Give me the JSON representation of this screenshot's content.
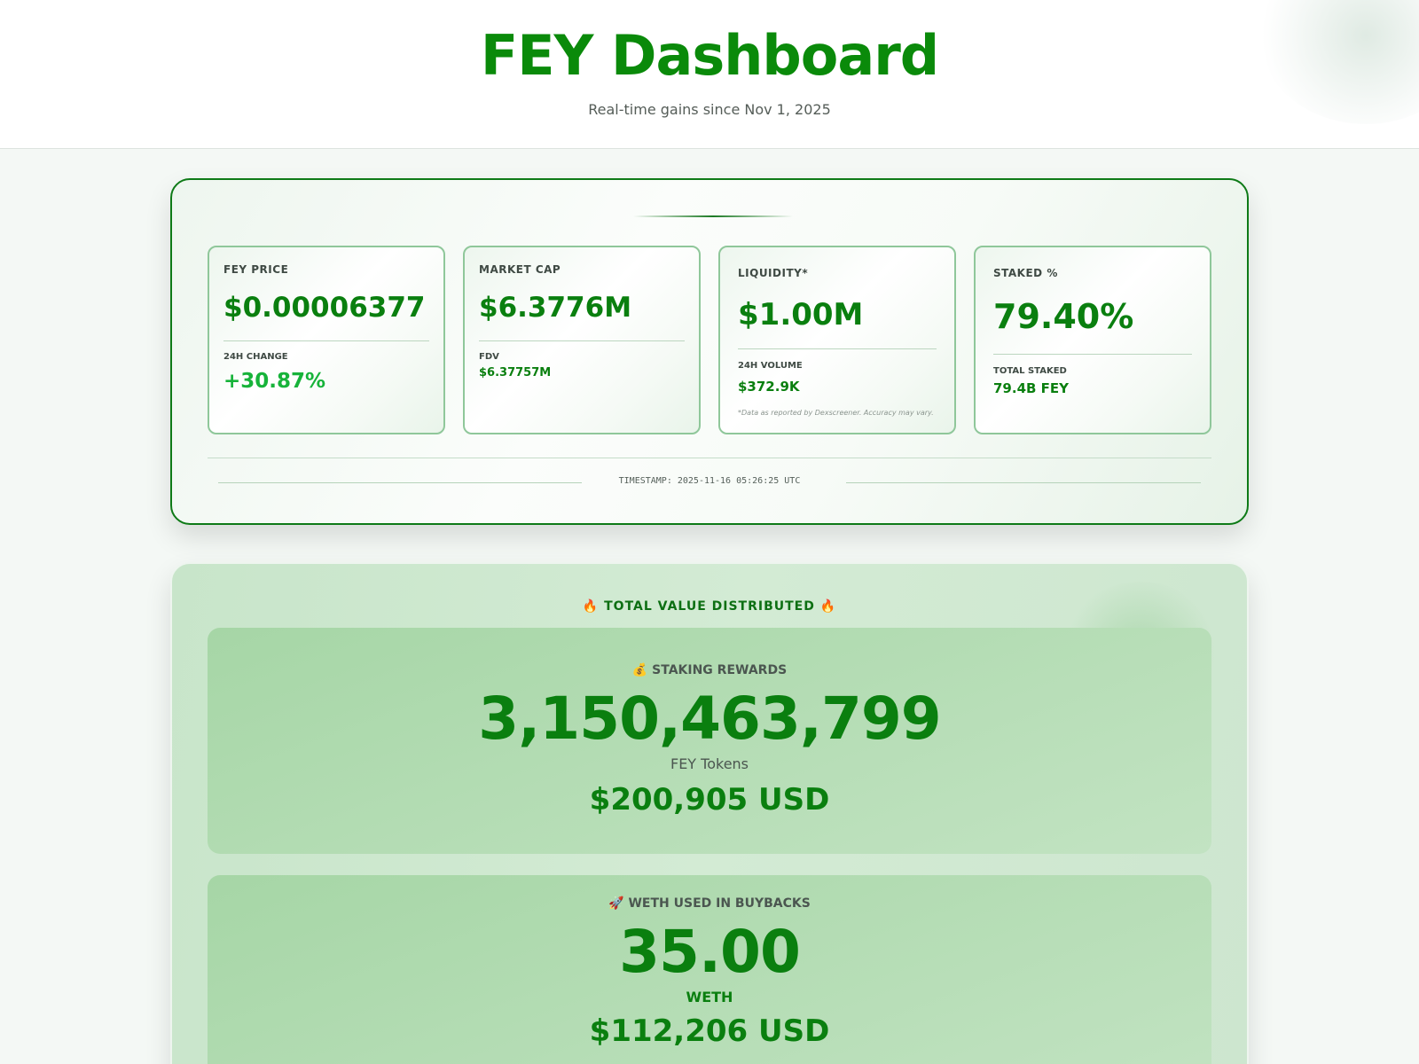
{
  "header": {
    "title": "FEY Dashboard",
    "subtitle": "Real-time gains since Nov 1, 2025"
  },
  "stats": [
    {
      "label": "FEY PRICE",
      "value": "$0.00006377",
      "sub_label": "24H CHANGE",
      "sub_value": "+30.87%"
    },
    {
      "label": "MARKET CAP",
      "value": "$6.3776M",
      "sub_label": "FDV",
      "sub_value": "$6.37757M"
    },
    {
      "label": "LIQUIDITY*",
      "value": "$1.00M",
      "sub_label": "24H VOLUME",
      "sub_value": "$372.9K",
      "note": "*Data as reported by Dexscreener. Accuracy may vary."
    },
    {
      "label": "STAKED %",
      "value": "79.40%",
      "sub_label": "TOTAL STAKED",
      "sub_value": "79.4B FEY"
    }
  ],
  "timestamp": "TIMESTAMP: 2025-11-16 05:26:25 UTC",
  "distribution": {
    "title": "🔥 TOTAL VALUE DISTRIBUTED 🔥",
    "staking": {
      "label": "💰 STAKING REWARDS",
      "amount": "3,150,463,799",
      "unit": "FEY Tokens",
      "usd": "$200,905 USD"
    },
    "buybacks": {
      "label": "🚀 WETH USED IN BUYBACKS",
      "amount": "35.00",
      "unit": "WETH",
      "usd": "$112,206 USD"
    }
  },
  "colors": {
    "accent": "#0a8a0a",
    "positive": "#17b33a"
  }
}
